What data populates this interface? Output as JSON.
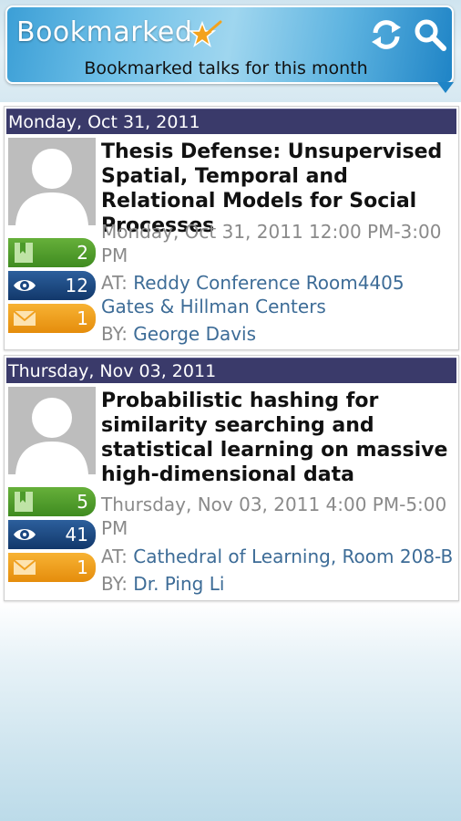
{
  "header": {
    "title": "Bookmarked",
    "subtitle": "Bookmarked talks for this month",
    "icons": [
      "star-icon",
      "refresh-icon",
      "search-icon"
    ]
  },
  "talks": [
    {
      "date_header": "Monday, Oct 31, 2011",
      "title": "Thesis Defense: Unsupervised Spatial, Temporal and Relational Models for Social Processes",
      "time": "Monday, Oct 31, 2011 12:00 PM-3:00 PM",
      "at_label": "AT:",
      "location": "Reddy Conference Room4405 Gates & Hillman Centers",
      "by_label": "BY:",
      "speaker": "George Davis",
      "bookmarks": "2",
      "views": "12",
      "emails": "1"
    },
    {
      "date_header": "Thursday, Nov 03, 2011",
      "title": "Probabilistic hashing for similarity searching and statistical learning on massive high-dimensional data",
      "time": "Thursday, Nov 03, 2011 4:00 PM-5:00 PM",
      "at_label": "AT:",
      "location": "Cathedral of Learning, Room 208-B",
      "by_label": "BY:",
      "speaker": "Dr. Ping Li",
      "bookmarks": "5",
      "views": "41",
      "emails": "1"
    }
  ],
  "colors": {
    "date_bar": "#3a3a6a",
    "link": "#3d6c97",
    "stat_green": "#4c9a2a",
    "stat_blue": "#1a4680",
    "stat_orange": "#f0a020"
  }
}
